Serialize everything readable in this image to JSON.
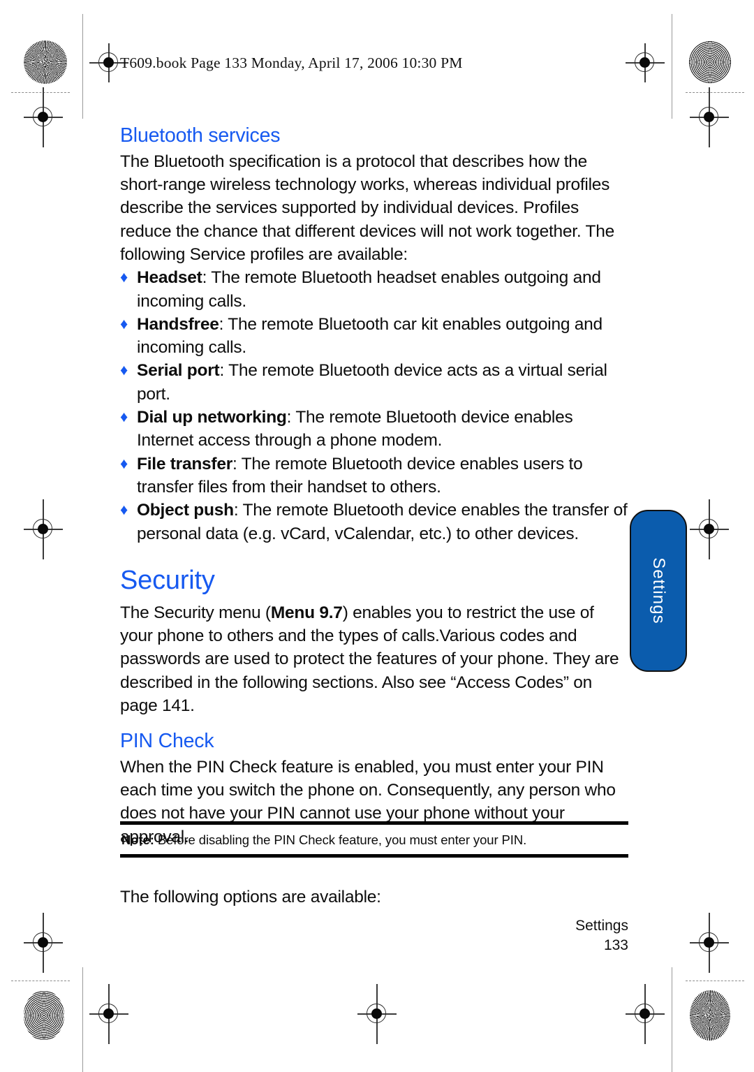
{
  "header": {
    "running_head": "T609.book  Page 133  Monday, April 17, 2006  10:30 PM"
  },
  "colors": {
    "heading_blue": "#1659f0",
    "tab_blue": "#0b5cad",
    "body_black": "#0d0d0d"
  },
  "content": {
    "bluetooth_services": {
      "title": "Bluetooth services",
      "intro": "The Bluetooth specification is a protocol that describes how the short-range wireless technology works, whereas individual profiles describe the services supported by individual devices. Profiles reduce the chance that different devices will not work together. The following Service profiles are available:",
      "profiles": [
        {
          "term": "Headset",
          "description": ": The remote Bluetooth headset enables outgoing and incoming calls."
        },
        {
          "term": "Handsfree",
          "description": ": The remote Bluetooth car kit enables outgoing and incoming calls."
        },
        {
          "term": "Serial port",
          "description": ": The remote Bluetooth device acts as a virtual serial port."
        },
        {
          "term": "Dial up networking",
          "description": ": The remote Bluetooth device enables Internet access through a phone modem."
        },
        {
          "term": "File transfer",
          "description": ": The remote Bluetooth device enables users to transfer files from their handset to others."
        },
        {
          "term": "Object push",
          "description": ": The remote Bluetooth device enables the transfer of personal data (e.g. vCard, vCalendar, etc.) to other devices."
        }
      ]
    },
    "security": {
      "title": "Security",
      "paragraph_part1": "The Security menu (",
      "menu_reference": "Menu 9.7",
      "paragraph_part2": ") enables you to restrict the use of your phone to others and the types of calls.Various codes and passwords are used to protect the features of your phone. They are described in the following sections. Also see “Access Codes” on page 141."
    },
    "pin_check": {
      "title": "PIN Check",
      "paragraph": "When the PIN Check feature is enabled, you must enter your PIN each time you switch the phone on. Consequently, any person who does not have your PIN cannot use your phone without your approval."
    },
    "note": {
      "label": "Note:",
      "text": " Before disabling the PIN Check feature, you must enter your PIN."
    },
    "trailing_line": "The following options are available:"
  },
  "side_tab": {
    "label": "Settings"
  },
  "footer": {
    "section": "Settings",
    "page_number": "133"
  },
  "icons": {
    "bullet": "♦"
  }
}
